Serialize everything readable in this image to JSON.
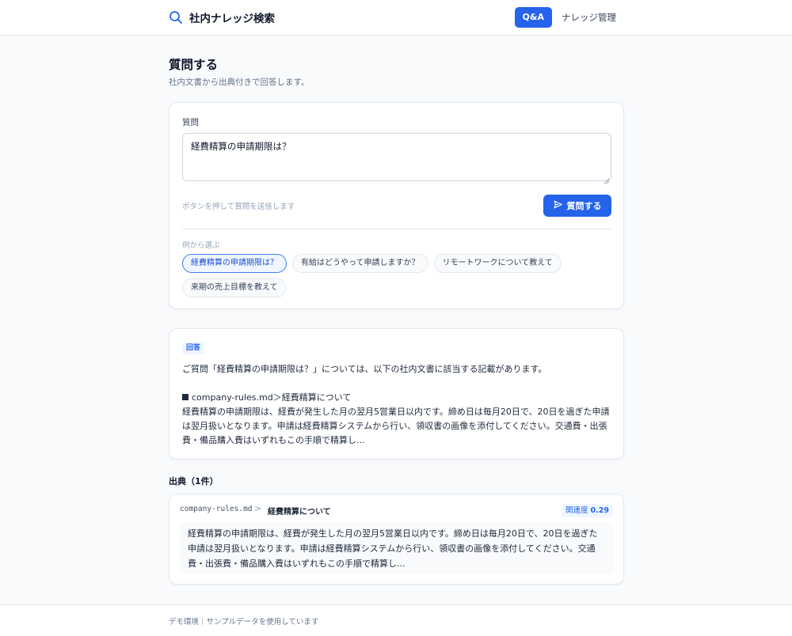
{
  "header": {
    "title": "社内ナレッジ検索",
    "brand_icon": "search-icon",
    "nav": [
      {
        "label": "Q&A",
        "active": true
      },
      {
        "label": "ナレッジ管理",
        "active": false
      }
    ]
  },
  "page": {
    "title": "質問する",
    "subtitle": "社内文書から出典付きで回答します。"
  },
  "question_form": {
    "label": "質問",
    "value": "経費精算の申請期限は？",
    "hint": "ボタンを押して質問を送信します",
    "submit_label": "質問する",
    "submit_icon": "send-icon",
    "examples_label": "例から選ぶ",
    "examples": [
      {
        "label": "経費精算の申請期限は？",
        "selected": true
      },
      {
        "label": "有給はどうやって申請しますか？",
        "selected": false
      },
      {
        "label": "リモートワークについて教えて",
        "selected": false
      },
      {
        "label": "来期の売上目標を教えて",
        "selected": false
      }
    ]
  },
  "answer": {
    "badge": "回答",
    "intro": "ご質問「経費精算の申請期限は？」については、以下の社内文書に該当する記載があります。",
    "source_title": "company-rules.md＞経費精算について",
    "body": "経費精算の申請期限は、経費が発生した月の翌月5営業日以内です。締め日は毎月20日で、20日を過ぎた申請は翌月扱いとなります。申請は経費精算システムから行い、領収書の画像を添付してください。交通費・出張費・備品購入費はいずれもこの手順で精算し..."
  },
  "sources": {
    "heading": "出典（1件）",
    "items": [
      {
        "file": "company-rules.md",
        "separator": ">",
        "section": "経費精算について",
        "score_label": "関連度",
        "score": "0.29",
        "excerpt": "経費精算の申請期限は、経費が発生した月の翌月5営業日以内です。締め日は毎月20日で、20日を過ぎた申請は翌月扱いとなります。申請は経費精算システムから行い、領収書の画像を添付してください。交通費・出張費・備品購入費はいずれもこの手順で精算し..."
      }
    ]
  },
  "footer": {
    "text": "デモ環境｜サンプルデータを使用しています"
  },
  "colors": {
    "accent": "#2563eb",
    "background": "#f8fafc",
    "card": "#ffffff",
    "border": "#e2e8f0"
  }
}
